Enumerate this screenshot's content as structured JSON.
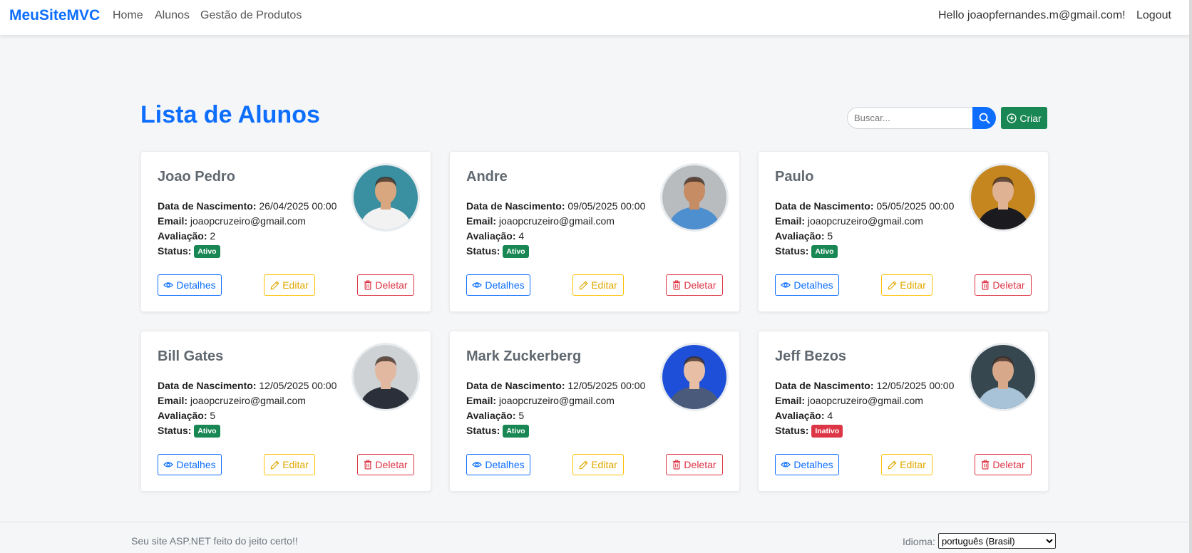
{
  "nav": {
    "brand": "MeuSiteMVC",
    "links": [
      "Home",
      "Alunos",
      "Gestão de Produtos"
    ],
    "greeting": "Hello joaopfernandes.m@gmail.com!",
    "logout": "Logout"
  },
  "page": {
    "title": "Lista de Alunos",
    "search_placeholder": "Buscar...",
    "create_label": "Criar"
  },
  "labels": {
    "birth": "Data de Nascimento:",
    "email": "Email:",
    "rating": "Avaliação:",
    "status": "Status:",
    "details": "Detalhes",
    "edit": "Editar",
    "delete": "Deletar"
  },
  "students": [
    {
      "name": "Joao Pedro",
      "birth": "26/04/2025 00:00",
      "email": "joaopcruzeiro@gmail.com",
      "rating": "2",
      "status": "Ativo",
      "bg": "#3a8fa0",
      "skin": "#d9a77f",
      "shirt": "#f2f2f2"
    },
    {
      "name": "Andre",
      "birth": "09/05/2025 00:00",
      "email": "joaopcruzeiro@gmail.com",
      "rating": "4",
      "status": "Ativo",
      "bg": "#b9bcbf",
      "skin": "#c68c64",
      "shirt": "#4e8fd0"
    },
    {
      "name": "Paulo",
      "birth": "05/05/2025 00:00",
      "email": "joaopcruzeiro@gmail.com",
      "rating": "5",
      "status": "Ativo",
      "bg": "#c5861f",
      "skin": "#e0b294",
      "shirt": "#1b1b1f"
    },
    {
      "name": "Bill Gates",
      "birth": "12/05/2025 00:00",
      "email": "joaopcruzeiro@gmail.com",
      "rating": "5",
      "status": "Ativo",
      "bg": "#cfd2d4",
      "skin": "#e2b8a0",
      "shirt": "#2b2f3a"
    },
    {
      "name": "Mark Zuckerberg",
      "birth": "12/05/2025 00:00",
      "email": "joaopcruzeiro@gmail.com",
      "rating": "5",
      "status": "Ativo",
      "bg": "#1d4fd8",
      "skin": "#e8bfa4",
      "shirt": "#4a5a7a"
    },
    {
      "name": "Jeff Bezos",
      "birth": "12/05/2025 00:00",
      "email": "joaopcruzeiro@gmail.com",
      "rating": "4",
      "status": "Inativo",
      "bg": "#37474f",
      "skin": "#d8a88a",
      "shirt": "#a8c3d8"
    }
  ],
  "footer": {
    "text": "Seu site ASP.NET feito do jeito certo!!",
    "lang_label": "Idioma:",
    "lang_value": "português (Brasil)"
  }
}
